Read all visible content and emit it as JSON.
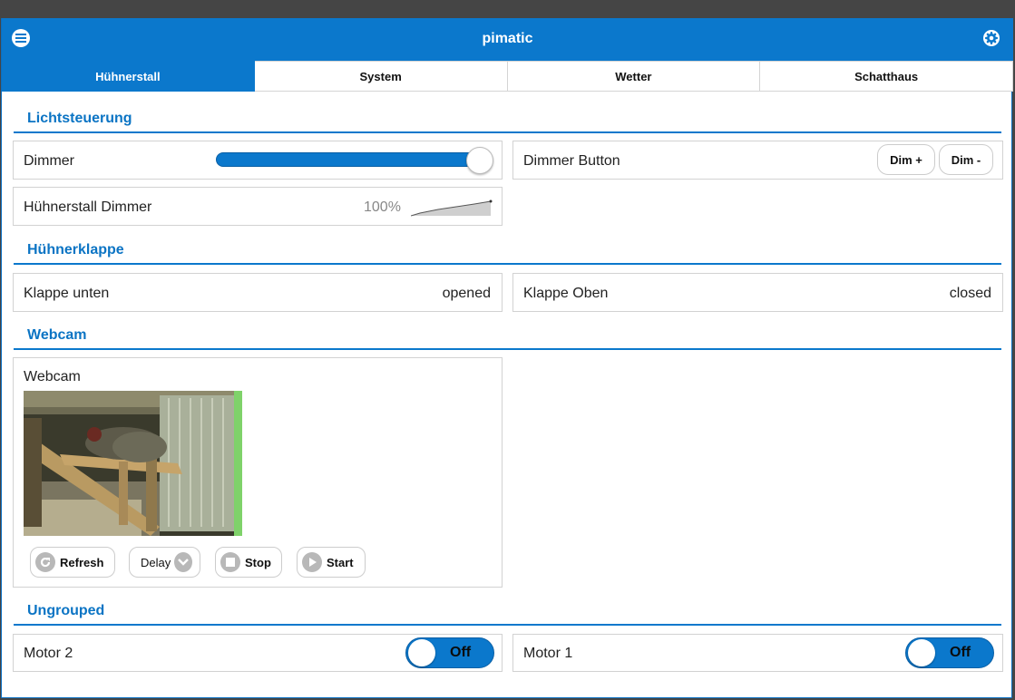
{
  "header": {
    "title": "pimatic"
  },
  "tabs": [
    {
      "label": "Hühnerstall",
      "active": true
    },
    {
      "label": "System"
    },
    {
      "label": "Wetter"
    },
    {
      "label": "Schatthaus"
    }
  ],
  "sections": {
    "light": "Lichtsteuerung",
    "hatch": "Hühnerklappe",
    "webcam": "Webcam",
    "ungrouped": "Ungrouped"
  },
  "devices": {
    "dimmer": {
      "label": "Dimmer",
      "level": 1.0
    },
    "dimmer_button": {
      "label": "Dimmer Button",
      "dim_plus": "Dim +",
      "dim_minus": "Dim -"
    },
    "stall_dimmer": {
      "label": "Hühnerstall Dimmer",
      "value": "100%"
    },
    "klappe_unten": {
      "label": "Klappe unten",
      "state": "opened"
    },
    "klappe_oben": {
      "label": "Klappe Oben",
      "state": "closed"
    },
    "webcam": {
      "label": "Webcam",
      "buttons": {
        "refresh": "Refresh",
        "delay": "Delay",
        "stop": "Stop",
        "start": "Start"
      }
    },
    "motor2": {
      "label": "Motor 2",
      "state": "Off"
    },
    "motor1": {
      "label": "Motor 1",
      "state": "Off"
    }
  },
  "colors": {
    "accent": "#0b78cc",
    "section_text": "#0b74c4"
  },
  "icons": {
    "menu": "menu-icon",
    "settings": "gear-icon",
    "refresh": "refresh-icon",
    "delay": "chevron-down-icon",
    "stop": "stop-icon",
    "start": "play-icon"
  }
}
